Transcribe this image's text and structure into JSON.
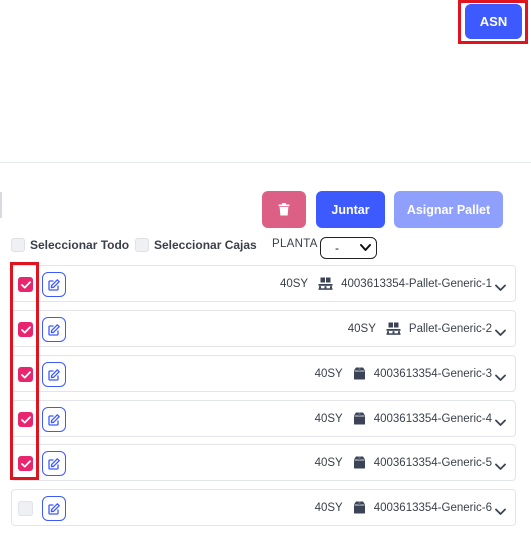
{
  "header": {
    "asn_label": "ASN"
  },
  "toolbar": {
    "delete_icon": "trash-icon",
    "join_label": "Juntar",
    "assign_label": "Asignar Pallet"
  },
  "filters": {
    "select_all_label": "Seleccionar Todo",
    "select_boxes_label": "Seleccionar Cajas",
    "planta_label": "PLANTA",
    "planta_value": "-"
  },
  "items": [
    {
      "checked": true,
      "code": "40SY",
      "icon": "pallet-icon",
      "name": "4003613354-Pallet-Generic-1"
    },
    {
      "checked": true,
      "code": "40SY",
      "icon": "pallet-icon",
      "name": "Pallet-Generic-2"
    },
    {
      "checked": true,
      "code": "40SY",
      "icon": "box-icon",
      "name": "4003613354-Generic-3"
    },
    {
      "checked": true,
      "code": "40SY",
      "icon": "box-icon",
      "name": "4003613354-Generic-4"
    },
    {
      "checked": true,
      "code": "40SY",
      "icon": "box-icon",
      "name": "4003613354-Generic-5"
    },
    {
      "checked": false,
      "code": "40SY",
      "icon": "box-icon",
      "name": "4003613354-Generic-6"
    }
  ],
  "colors": {
    "primary": "#3d5afe",
    "primary_light": "#8fa0fc",
    "danger": "#dc5f86",
    "checkbox_checked": "#e7266f",
    "highlight": "#e0141e"
  }
}
